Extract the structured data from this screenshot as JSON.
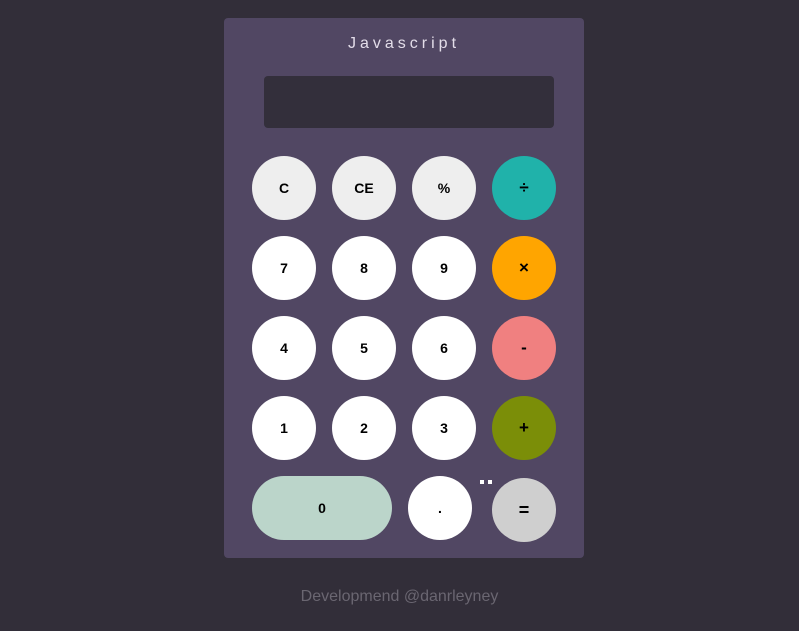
{
  "calculator": {
    "title": "Javascript",
    "display_value": "",
    "buttons": {
      "clear": "C",
      "clear_entry": "CE",
      "percent": "%",
      "divide": "÷",
      "seven": "7",
      "eight": "8",
      "nine": "9",
      "multiply": "×",
      "four": "4",
      "five": "5",
      "six": "6",
      "subtract": "-",
      "one": "1",
      "two": "2",
      "three": "3",
      "add": "+",
      "zero": "0",
      "decimal": ".",
      "equals": "="
    }
  },
  "footer": {
    "text": "Developmend @danrleyney"
  },
  "colors": {
    "background": "#322e39",
    "panel": "#514763",
    "display": "#332f3b",
    "divide": "#20b2aa",
    "multiply": "#ffa500",
    "subtract": "#f08080",
    "add": "#7b8e08",
    "equals": "#cfcfcf",
    "zero": "#bbd5ca"
  }
}
